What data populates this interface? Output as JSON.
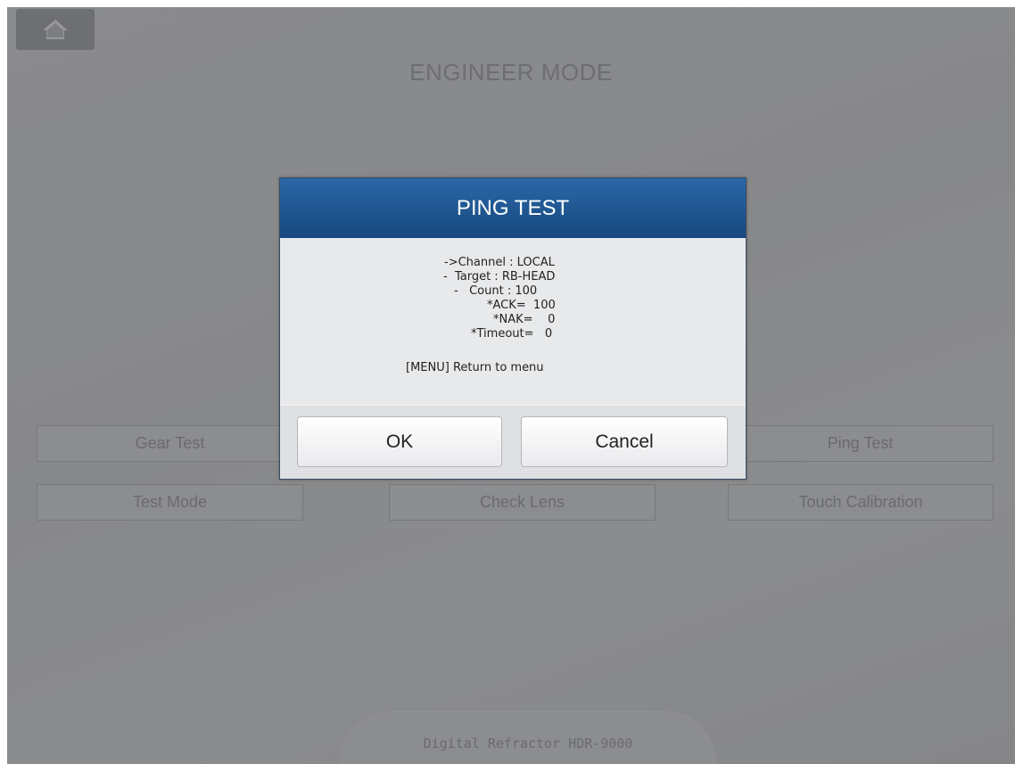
{
  "header": {
    "title": "ENGINEER MODE",
    "home_icon": "home-icon"
  },
  "buttons": {
    "gear_test": "Gear Test",
    "ping_test": "Ping Test",
    "test_mode": "Test Mode",
    "check_lens": "Check Lens",
    "touch_calibration": "Touch Calibration"
  },
  "footer": {
    "label": "Digital Refractor HDR-9000"
  },
  "dialog": {
    "title": "PING TEST",
    "channel": "->Channel : LOCAL",
    "target": "-  Target : RB-HEAD",
    "count": "-   Count : 100",
    "ack": "*ACK=  100",
    "nak": "*NAK=    0",
    "timeout": "*Timeout=   0",
    "hint": "[MENU] Return to menu",
    "ok_label": "OK",
    "cancel_label": "Cancel"
  },
  "colors": {
    "dialog_header": "#1f5794",
    "dimmed_background": "#88898b"
  }
}
